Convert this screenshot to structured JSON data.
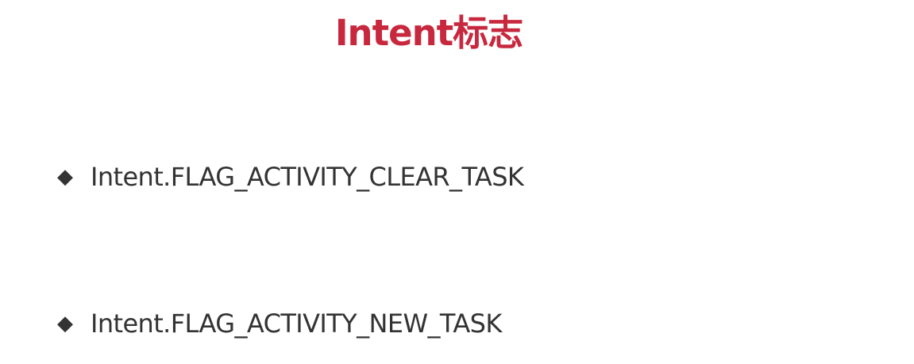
{
  "slide": {
    "title": "Intent标志",
    "title_color": "#c8283e",
    "text_color": "#333333",
    "bullet_marker": "◆",
    "bullets": [
      {
        "text": "Intent.FLAG_ACTIVITY_CLEAR_TASK"
      },
      {
        "text": "Intent.FLAG_ACTIVITY_NEW_TASK"
      }
    ]
  }
}
